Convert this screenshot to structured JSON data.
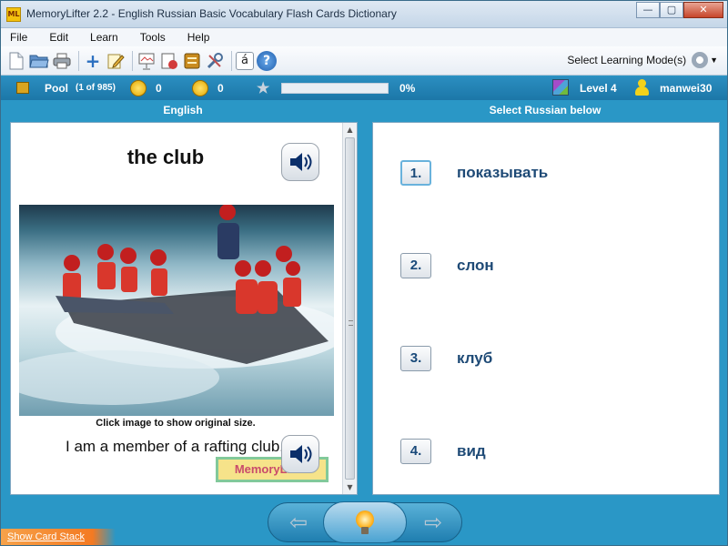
{
  "window": {
    "icon_text": "ML",
    "title": "MemoryLifter 2.2 - English Russian Basic Vocabulary Flash Cards Dictionary",
    "minimize": "—",
    "maximize": "▢",
    "close": "✕"
  },
  "menu": [
    "File",
    "Edit",
    "Learn",
    "Tools",
    "Help"
  ],
  "toolbar": {
    "mode_label": "Select Learning Mode(s)",
    "icons": [
      "new-file-icon",
      "open-folder-icon",
      "print-icon",
      "add-card-icon",
      "edit-icon",
      "slideshow-icon",
      "statistics-icon",
      "card-box-icon",
      "tools-icon",
      "character-map-icon",
      "help-icon"
    ],
    "char_glyph": "á",
    "help_glyph": "?",
    "add_glyph": "+"
  },
  "status": {
    "pool_label": "Pool",
    "pool_count": "(1 of 985)",
    "correct_count": "0",
    "wrong_count": "0",
    "progress_percent": 0,
    "progress_text": "0%",
    "level": "Level 4",
    "username": "manwei30"
  },
  "question": {
    "language": "English",
    "word": "the club",
    "caption": "Click image to show original size.",
    "sentence": "I am a member of a rafting club.",
    "watermark": "MemoryLifter"
  },
  "answers": {
    "header": "Select Russian below",
    "items": [
      {
        "num": "1.",
        "text": "показывать"
      },
      {
        "num": "2.",
        "text": "слон"
      },
      {
        "num": "3.",
        "text": "клуб"
      },
      {
        "num": "4.",
        "text": "вид"
      }
    ]
  },
  "bottom": {
    "show_card_stack": "Show Card Stack",
    "prev": "⇦",
    "next": "⇨"
  },
  "colors": {
    "background": "#2a97c6",
    "answer_text": "#1e4a76",
    "accent": "#f47a22"
  }
}
